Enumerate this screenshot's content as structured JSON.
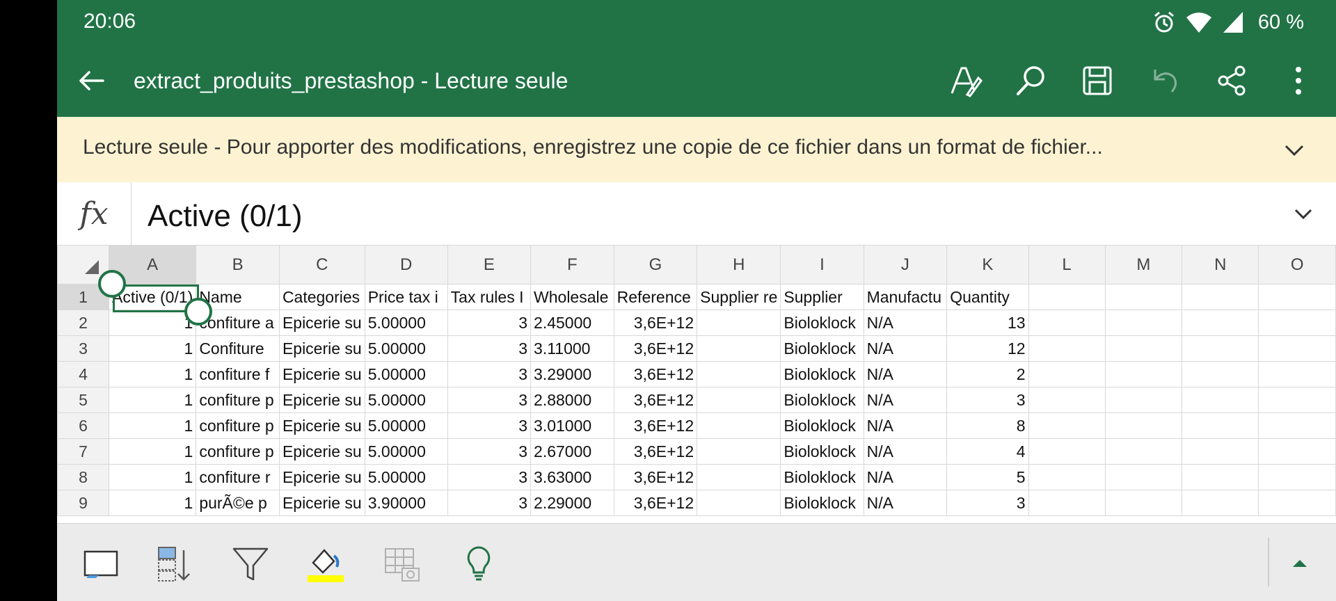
{
  "status_bar": {
    "time": "20:06",
    "battery": "60 %",
    "icons": [
      "alarm-icon",
      "wifi-icon",
      "signal-icon"
    ]
  },
  "app_bar": {
    "title": "extract_produits_prestashop - Lecture seule",
    "icons": [
      "back-arrow-icon",
      "draw-pen-icon",
      "search-icon",
      "save-icon",
      "undo-icon",
      "share-icon",
      "more-vert-icon"
    ]
  },
  "info_bar": {
    "message": "Lecture seule - Pour apporter des modifications, enregistrez une copie de ce fichier dans un format de fichier..."
  },
  "formula_bar": {
    "fx_label": "fx",
    "value": "Active (0/1)"
  },
  "grid": {
    "columns": [
      "A",
      "B",
      "C",
      "D",
      "E",
      "F",
      "G",
      "H",
      "I",
      "J",
      "K",
      "L",
      "M",
      "N",
      "O"
    ],
    "selected_column": "A",
    "rows": [
      {
        "n": "1",
        "cells": [
          "Active (0/1)",
          "Name",
          "Categories",
          "Price tax i",
          "Tax rules I",
          "Wholesale",
          "Reference",
          "Supplier re",
          "Supplier",
          "Manufactu",
          "Quantity",
          "",
          "",
          "",
          ""
        ]
      },
      {
        "n": "2",
        "cells": [
          "1",
          "confiture a",
          "Epicerie su",
          "5.00000",
          "3",
          "2.45000",
          "3,6E+12",
          "",
          "Bioloklock",
          "N/A",
          "13",
          "",
          "",
          "",
          ""
        ]
      },
      {
        "n": "3",
        "cells": [
          "1",
          "Confiture",
          "Epicerie su",
          "5.00000",
          "3",
          "3.11000",
          "3,6E+12",
          "",
          "Bioloklock",
          "N/A",
          "12",
          "",
          "",
          "",
          ""
        ]
      },
      {
        "n": "4",
        "cells": [
          "1",
          "confiture f",
          "Epicerie su",
          "5.00000",
          "3",
          "3.29000",
          "3,6E+12",
          "",
          "Bioloklock",
          "N/A",
          "2",
          "",
          "",
          "",
          ""
        ]
      },
      {
        "n": "5",
        "cells": [
          "1",
          "confiture p",
          "Epicerie su",
          "5.00000",
          "3",
          "2.88000",
          "3,6E+12",
          "",
          "Bioloklock",
          "N/A",
          "3",
          "",
          "",
          "",
          ""
        ]
      },
      {
        "n": "6",
        "cells": [
          "1",
          "confiture p",
          "Epicerie su",
          "5.00000",
          "3",
          "3.01000",
          "3,6E+12",
          "",
          "Bioloklock",
          "N/A",
          "8",
          "",
          "",
          "",
          ""
        ]
      },
      {
        "n": "7",
        "cells": [
          "1",
          "confiture p",
          "Epicerie su",
          "5.00000",
          "3",
          "2.67000",
          "3,6E+12",
          "",
          "Bioloklock",
          "N/A",
          "4",
          "",
          "",
          "",
          ""
        ]
      },
      {
        "n": "8",
        "cells": [
          "1",
          "confiture r",
          "Epicerie su",
          "5.00000",
          "3",
          "3.63000",
          "3,6E+12",
          "",
          "Bioloklock",
          "N/A",
          "5",
          "",
          "",
          "",
          ""
        ]
      },
      {
        "n": "9",
        "cells": [
          "1",
          "purÃ©e p",
          "Epicerie su",
          "3.90000",
          "3",
          "2.29000",
          "3,6E+12",
          "",
          "Bioloklock",
          "N/A",
          "3",
          "",
          "",
          "",
          ""
        ]
      }
    ]
  },
  "bottom_toolbar": {
    "icons": [
      "freeze-panes-icon",
      "sort-icon",
      "filter-icon",
      "fill-color-icon",
      "insert-picture-icon",
      "ideas-lightbulb-icon",
      "expand-up-icon"
    ],
    "fill_color": "#ffff00"
  },
  "colors": {
    "header_green": "#217346",
    "info_yellow": "#fdf3d2"
  }
}
